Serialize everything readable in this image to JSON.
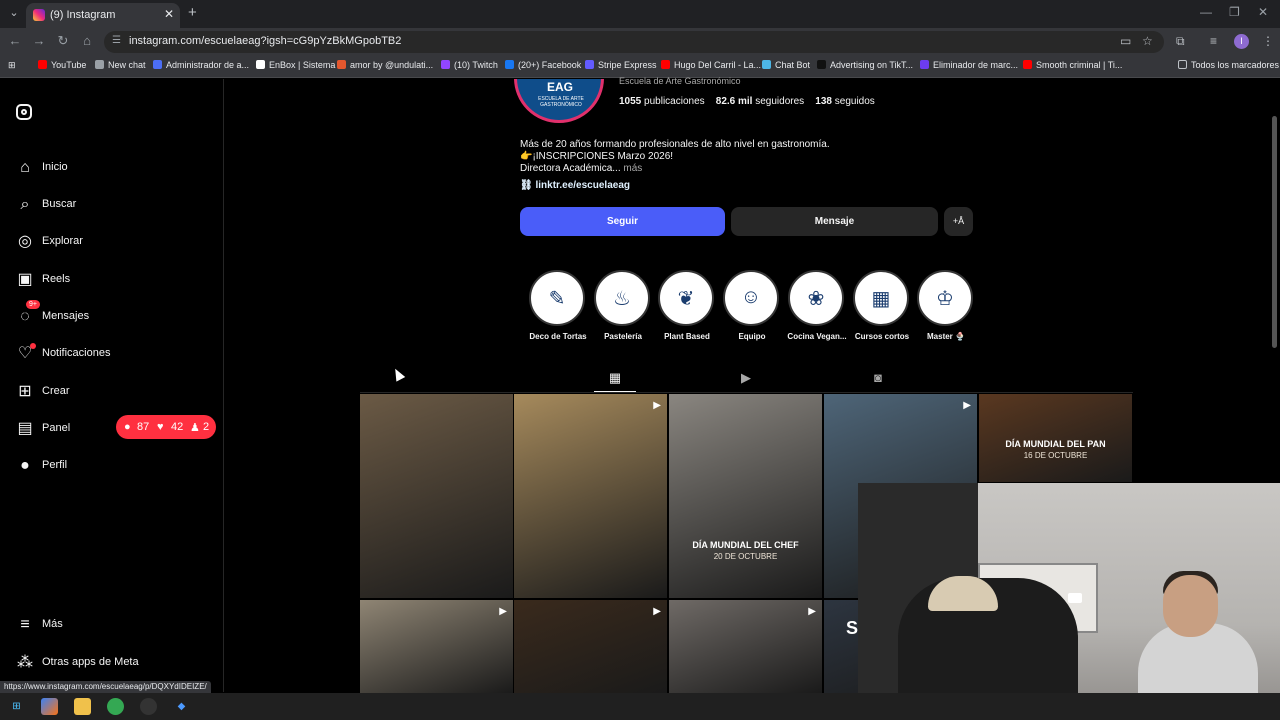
{
  "browser": {
    "tab_title": "(9) Instagram",
    "url": "instagram.com/escuelaeag?igsh=cG9pYzBkMGpobTB2",
    "bookmarks": [
      {
        "label": "YouTube",
        "color": "#ff0000"
      },
      {
        "label": "New chat",
        "color": "#9aa0a6"
      },
      {
        "label": "Administrador de a...",
        "color": "#4c6ef5"
      },
      {
        "label": "EnBox | Sistema",
        "color": "#ffffff"
      },
      {
        "label": "amor by @undulati...",
        "color": "#e4572e"
      },
      {
        "label": "(10) Twitch",
        "color": "#9146ff"
      },
      {
        "label": "(20+) Facebook",
        "color": "#1877f2"
      },
      {
        "label": "Stripe Express",
        "color": "#635bff"
      },
      {
        "label": "Hugo Del Carril - La...",
        "color": "#ff0000"
      },
      {
        "label": "Chat Bot",
        "color": "#4db6e6"
      },
      {
        "label": "Advertising on TikT...",
        "color": "#111111"
      },
      {
        "label": "Eliminador de marc...",
        "color": "#6c3cf0"
      },
      {
        "label": "Smooth criminal | Ti...",
        "color": "#ff0000"
      }
    ],
    "bookmarks_folder": "Todos los marcadores",
    "status_url": "https://www.instagram.com/escuelaeag/p/DQXYdIDEIZE/"
  },
  "sidebar": {
    "items": [
      {
        "label": "Inicio",
        "icon": "home-icon",
        "glyph": "⌂"
      },
      {
        "label": "Buscar",
        "icon": "search-icon",
        "glyph": "⌕"
      },
      {
        "label": "Explorar",
        "icon": "compass-icon",
        "glyph": "◎"
      },
      {
        "label": "Reels",
        "icon": "reels-icon",
        "glyph": "▣"
      },
      {
        "label": "Mensajes",
        "icon": "messenger-icon",
        "glyph": "◌"
      },
      {
        "label": "Notificaciones",
        "icon": "heart-icon",
        "glyph": "♡"
      },
      {
        "label": "Crear",
        "icon": "plus-square-icon",
        "glyph": "⊞"
      },
      {
        "label": "Panel",
        "icon": "dashboard-icon",
        "glyph": "▤"
      },
      {
        "label": "Perfil",
        "icon": "avatar-icon",
        "glyph": "●"
      }
    ],
    "messages_badge": "9+",
    "bottom": [
      {
        "label": "Más",
        "icon": "menu-icon",
        "glyph": "≡"
      },
      {
        "label": "Otras apps de Meta",
        "icon": "meta-apps-icon",
        "glyph": "⁂"
      }
    ],
    "notif_pill": {
      "comments": "87",
      "likes": "42",
      "follows": "2"
    }
  },
  "profile": {
    "avatar_text": "EAG",
    "avatar_sub": "ESCUELA DE ARTE GASTRONÓMICO",
    "name": "Escuela de Arte Gastronómico",
    "posts_count": "1055",
    "posts_label": "publicaciones",
    "followers_count": "82.6 mil",
    "followers_label": "seguidores",
    "following_count": "138",
    "following_label": "seguidos",
    "bio_line1": "Más de 20 años formando profesionales de alto nivel en gastronomía.",
    "bio_line2": "👉¡INSCRIPCIONES Marzo 2026!",
    "bio_line3": "Directora Académica...",
    "bio_more": "más",
    "link": "linktr.ee/escuelaeag",
    "follow_label": "Seguir",
    "message_label": "Mensaje",
    "add_label": "+Å"
  },
  "highlights": [
    {
      "label": "Deco de Tortas",
      "glyph": "✎"
    },
    {
      "label": "Pastelería",
      "glyph": "♨"
    },
    {
      "label": "Plant Based",
      "glyph": "❦"
    },
    {
      "label": "Equipo",
      "glyph": "☺"
    },
    {
      "label": "Cocina Vegan...",
      "glyph": "❀"
    },
    {
      "label": "Cursos cortos",
      "glyph": "▦"
    },
    {
      "label": "Master 🍨",
      "glyph": "♔"
    }
  ],
  "posts": [
    {
      "bg": "#6b5a45",
      "caption": "",
      "sub": "",
      "icon": ""
    },
    {
      "bg": "#a68a5c",
      "caption": "",
      "sub": "",
      "icon": "▶"
    },
    {
      "bg": "#8a8680",
      "caption": "DÍA MUNDIAL DEL CHEF",
      "sub": "20 DE OCTUBRE",
      "icon": ""
    },
    {
      "bg": "#4e6578",
      "caption": "",
      "sub": "",
      "icon": "▶"
    },
    {
      "bg": "#5a3820",
      "caption": "DÍA MUNDIAL DEL PAN",
      "sub": "16 DE OCTUBRE",
      "icon": ""
    },
    {
      "bg": "#8f8574",
      "caption": "",
      "sub": "",
      "icon": "▶"
    },
    {
      "bg": "#3a2a1c",
      "caption": "",
      "sub": "",
      "icon": "▶"
    },
    {
      "bg": "#6f6a66",
      "caption": "",
      "sub": "",
      "icon": "▶"
    },
    {
      "bg": "#2d3540",
      "caption": "S",
      "sub": "",
      "icon": ""
    }
  ]
}
